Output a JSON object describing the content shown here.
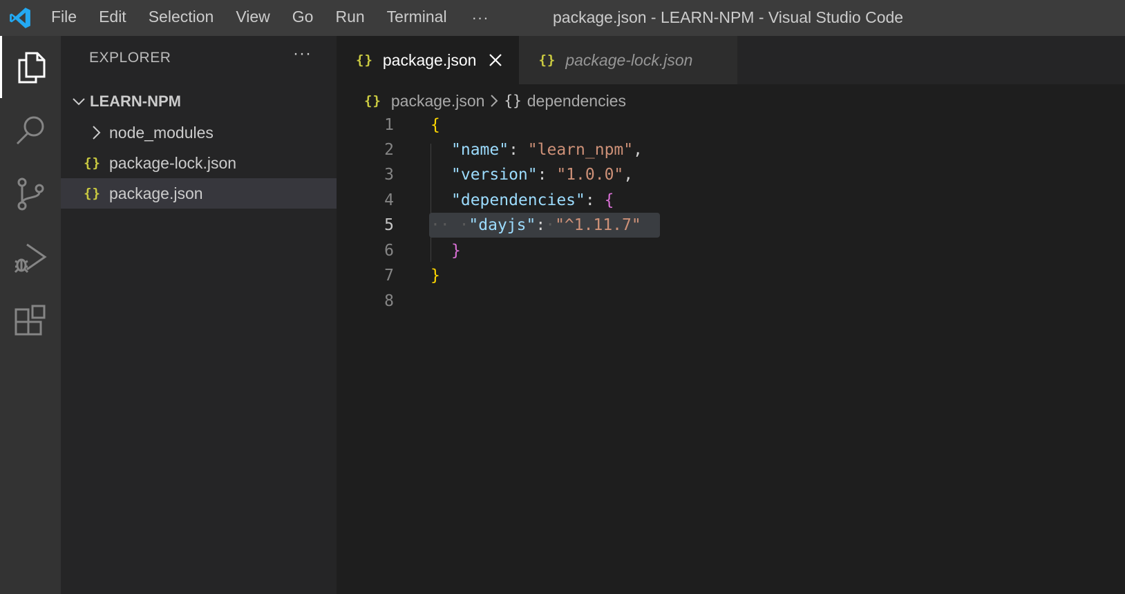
{
  "titlebar": {
    "menu": [
      "File",
      "Edit",
      "Selection",
      "View",
      "Go",
      "Run",
      "Terminal"
    ],
    "more": "···",
    "window_title": "package.json - LEARN-NPM - Visual Studio Code"
  },
  "activitybar": {
    "icons": [
      "explorer-icon",
      "search-icon",
      "source-control-icon",
      "run-debug-icon",
      "extensions-icon"
    ],
    "active": "explorer-icon"
  },
  "sidebar": {
    "header": "EXPLORER",
    "more": "···",
    "folder": "LEARN-NPM",
    "items": [
      {
        "label": "node_modules",
        "type": "folder",
        "icon": "chevron-right-icon"
      },
      {
        "label": "package-lock.json",
        "type": "file",
        "icon": "json-icon"
      },
      {
        "label": "package.json",
        "type": "file",
        "icon": "json-icon",
        "selected": true
      }
    ]
  },
  "tabs": [
    {
      "label": "package.json",
      "active": true,
      "icon": "{}"
    },
    {
      "label": "package-lock.json",
      "active": false,
      "preview": true,
      "icon": "{}"
    }
  ],
  "breadcrumb": {
    "file": "package.json",
    "symbol_icon": "{}",
    "symbol": "dependencies"
  },
  "editor": {
    "current_line": 5,
    "line_numbers": [
      "1",
      "2",
      "3",
      "4",
      "5",
      "6",
      "7",
      "8"
    ],
    "lines": [
      {
        "brace_open": "{"
      },
      {
        "key": "\"name\"",
        "colon": ": ",
        "value": "\"learn_npm\"",
        "comma": ","
      },
      {
        "key": "\"version\"",
        "colon": ": ",
        "value": "\"1.0.0\"",
        "comma": ","
      },
      {
        "key": "\"dependencies\"",
        "colon": ": ",
        "brace": "{"
      },
      {
        "key": "\"dayjs\"",
        "colon": ":",
        "value": "\"^1.11.7\""
      },
      {
        "brace_close": "}"
      },
      {
        "brace_close": "}"
      },
      {}
    ]
  },
  "colors": {
    "key": "#9cdcfe",
    "string": "#ce9178",
    "brace_level1": "#ffd700",
    "brace_level2": "#da70d6",
    "json_icon": "#cbcb41",
    "vscode_blue": "#23a9f2"
  }
}
